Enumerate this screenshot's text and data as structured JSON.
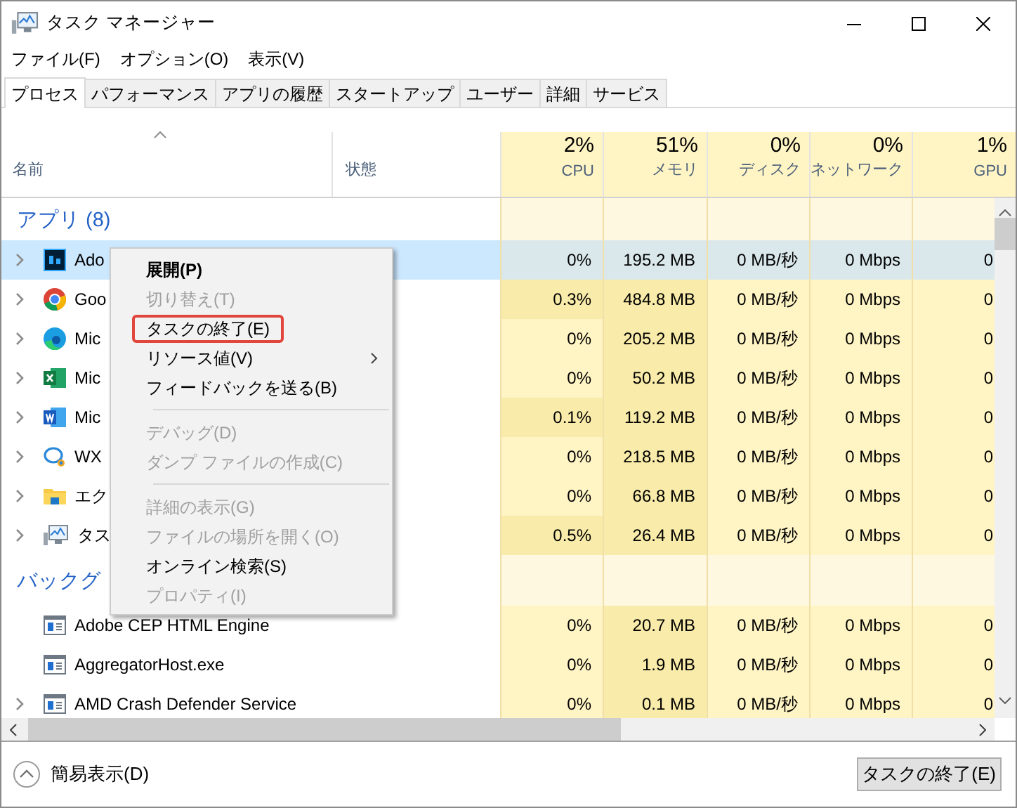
{
  "window": {
    "title": "タスク マネージャー"
  },
  "menu": [
    "ファイル(F)",
    "オプション(O)",
    "表示(V)"
  ],
  "tabs": [
    {
      "label": "プロセス",
      "selected": true
    },
    {
      "label": "パフォーマンス",
      "selected": false
    },
    {
      "label": "アプリの履歴",
      "selected": false
    },
    {
      "label": "スタートアップ",
      "selected": false
    },
    {
      "label": "ユーザー",
      "selected": false
    },
    {
      "label": "詳細",
      "selected": false
    },
    {
      "label": "サービス",
      "selected": false
    }
  ],
  "columns": [
    {
      "label": "名前",
      "sorted": true
    },
    {
      "label": "状態"
    },
    {
      "label": "CPU",
      "total": "2%"
    },
    {
      "label": "メモリ",
      "total": "51%"
    },
    {
      "label": "ディスク",
      "total": "0%"
    },
    {
      "label": "ネットワーク",
      "total": "0%"
    },
    {
      "label": "GPU",
      "total": "1%"
    }
  ],
  "groups": [
    {
      "title": "アプリ (8)",
      "rows": [
        {
          "name": "Ado",
          "kind": "ps",
          "expandable": true,
          "selected": true,
          "cpu_hot": false,
          "cells": [
            "0%",
            "195.2 MB",
            "0 MB/秒",
            "0 Mbps",
            "0"
          ]
        },
        {
          "name": "Goo",
          "kind": "chrome",
          "expandable": true,
          "selected": false,
          "cpu_hot": true,
          "cells": [
            "0.3%",
            "484.8 MB",
            "0 MB/秒",
            "0 Mbps",
            "0"
          ]
        },
        {
          "name": "Mic",
          "kind": "edge",
          "expandable": true,
          "selected": false,
          "cpu_hot": false,
          "cells": [
            "0%",
            "205.2 MB",
            "0 MB/秒",
            "0 Mbps",
            "0"
          ]
        },
        {
          "name": "Mic",
          "kind": "excel",
          "expandable": true,
          "selected": false,
          "cpu_hot": false,
          "cells": [
            "0%",
            "50.2 MB",
            "0 MB/秒",
            "0 Mbps",
            "0"
          ]
        },
        {
          "name": "Mic",
          "kind": "word",
          "expandable": true,
          "selected": false,
          "cpu_hot": true,
          "cells": [
            "0.1%",
            "119.2 MB",
            "0 MB/秒",
            "0 Mbps",
            "0"
          ]
        },
        {
          "name": "WX",
          "kind": "chat",
          "expandable": true,
          "selected": false,
          "cpu_hot": false,
          "cells": [
            "0%",
            "218.5 MB",
            "0 MB/秒",
            "0 Mbps",
            "0"
          ]
        },
        {
          "name": "エク",
          "kind": "folder",
          "expandable": true,
          "selected": false,
          "cpu_hot": false,
          "cells": [
            "0%",
            "66.8 MB",
            "0 MB/秒",
            "0 Mbps",
            "0"
          ]
        },
        {
          "name": "タス",
          "kind": "taskmgr",
          "expandable": true,
          "selected": false,
          "cpu_hot": true,
          "cells": [
            "0.5%",
            "26.4 MB",
            "0 MB/秒",
            "0 Mbps",
            "0"
          ]
        }
      ]
    },
    {
      "title": "バックグ",
      "rows": [
        {
          "name": "Adobe CEP HTML Engine",
          "kind": "service",
          "expandable": false,
          "selected": false,
          "cpu_hot": false,
          "cells": [
            "0%",
            "20.7 MB",
            "0 MB/秒",
            "0 Mbps",
            "0"
          ]
        },
        {
          "name": "AggregatorHost.exe",
          "kind": "service",
          "expandable": false,
          "selected": false,
          "cpu_hot": false,
          "cells": [
            "0%",
            "1.9 MB",
            "0 MB/秒",
            "0 Mbps",
            "0"
          ]
        },
        {
          "name": "AMD Crash Defender Service",
          "kind": "service",
          "expandable": true,
          "selected": false,
          "cpu_hot": false,
          "cells": [
            "0%",
            "0.1 MB",
            "0 MB/秒",
            "0 Mbps",
            "0"
          ]
        }
      ]
    }
  ],
  "context_menu": {
    "items": [
      {
        "kind": "item",
        "label": "展開(P)",
        "default": true,
        "disabled": false,
        "highlighted": false,
        "submenu": false
      },
      {
        "kind": "item",
        "label": "切り替え(T)",
        "default": false,
        "disabled": true,
        "highlighted": false,
        "submenu": false
      },
      {
        "kind": "item",
        "label": "タスクの終了(E)",
        "default": false,
        "disabled": false,
        "highlighted": true,
        "submenu": false
      },
      {
        "kind": "item",
        "label": "リソース値(V)",
        "default": false,
        "disabled": false,
        "highlighted": false,
        "submenu": true
      },
      {
        "kind": "item",
        "label": "フィードバックを送る(B)",
        "default": false,
        "disabled": false,
        "highlighted": false,
        "submenu": false
      },
      {
        "kind": "separator"
      },
      {
        "kind": "item",
        "label": "デバッグ(D)",
        "default": false,
        "disabled": true,
        "highlighted": false,
        "submenu": false
      },
      {
        "kind": "item",
        "label": "ダンプ ファイルの作成(C)",
        "default": false,
        "disabled": true,
        "highlighted": false,
        "submenu": false
      },
      {
        "kind": "separator"
      },
      {
        "kind": "item",
        "label": "詳細の表示(G)",
        "default": false,
        "disabled": true,
        "highlighted": false,
        "submenu": false
      },
      {
        "kind": "item",
        "label": "ファイルの場所を開く(O)",
        "default": false,
        "disabled": true,
        "highlighted": false,
        "submenu": false
      },
      {
        "kind": "item",
        "label": "オンライン検索(S)",
        "default": false,
        "disabled": false,
        "highlighted": false,
        "submenu": false
      },
      {
        "kind": "item",
        "label": "プロパティ(I)",
        "default": false,
        "disabled": true,
        "highlighted": false,
        "submenu": false
      }
    ]
  },
  "footer": {
    "toggle": "簡易表示(D)",
    "button": "タスクの終了(E)"
  }
}
